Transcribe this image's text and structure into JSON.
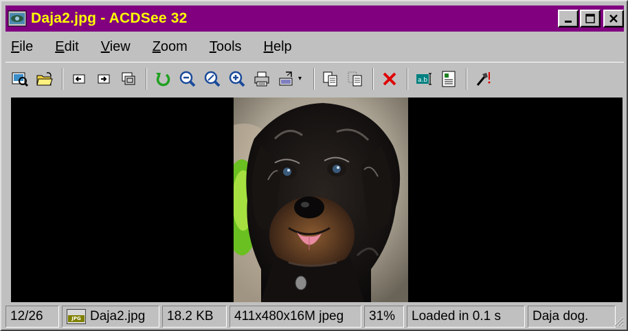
{
  "window": {
    "title": "Daja2.jpg - ACDSee 32",
    "accent_color": "#800080",
    "title_text_color": "#ffff00"
  },
  "title_buttons": {
    "minimize_icon": "minimize-icon",
    "maximize_icon": "maximize-icon",
    "close_icon": "close-icon"
  },
  "menu": {
    "items": [
      {
        "label": "File",
        "mnemonic": "F"
      },
      {
        "label": "Edit",
        "mnemonic": "E"
      },
      {
        "label": "View",
        "mnemonic": "V"
      },
      {
        "label": "Zoom",
        "mnemonic": "Z"
      },
      {
        "label": "Tools",
        "mnemonic": "T"
      },
      {
        "label": "Help",
        "mnemonic": "H"
      }
    ]
  },
  "toolbar": {
    "icons": [
      "browse-icon",
      "open-folder-icon",
      "previous-icon",
      "next-icon",
      "full-screen-icon",
      "rotate-icon",
      "zoom-out-icon",
      "zoom-fit-icon",
      "zoom-in-icon",
      "print-icon",
      "slideshow-icon",
      "copy-icon",
      "paste-icon",
      "delete-icon",
      "rename-icon",
      "properties-icon",
      "tools-icon"
    ]
  },
  "viewer": {
    "image_description": "dog-photo",
    "background": "#000000"
  },
  "status": {
    "position": "12/26",
    "filename": "Daja2.jpg",
    "file_type_badge": "JPG",
    "filesize": "18.2 KB",
    "dimensions": "411x480x16M jpeg",
    "zoom": "31%",
    "load_time": "Loaded in 0.1 s",
    "description": "Daja dog."
  }
}
